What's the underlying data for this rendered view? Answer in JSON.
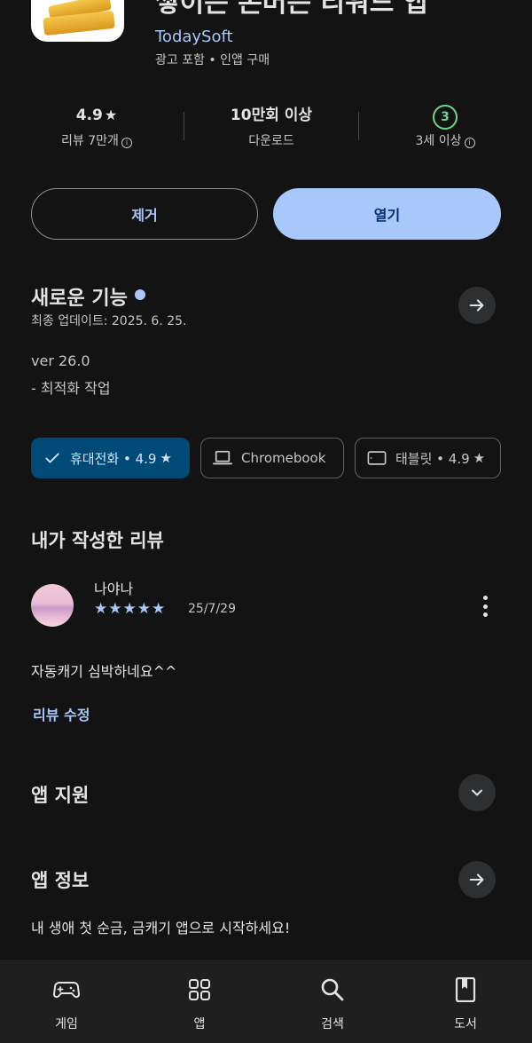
{
  "app": {
    "title": "쌓이는 돈버는 리워드 앱",
    "developer": "TodaySoft",
    "meta": "광고 포함 • 인앱 구매"
  },
  "stats": {
    "rating_value": "4.9",
    "rating_label": "리뷰 7만개",
    "downloads_value": "10만회 이상",
    "downloads_label": "다운로드",
    "age_value": "3",
    "age_label": "3세 이상"
  },
  "actions": {
    "uninstall_label": "제거",
    "open_label": "열기"
  },
  "whats_new": {
    "title": "새로운 기능",
    "last_updated": "최종 업데이트: 2025. 6. 25.",
    "version": "ver 26.0",
    "change": "- 최적화 작업"
  },
  "device_chips": [
    {
      "label": "휴대전화 • 4.9",
      "selected": true
    },
    {
      "label": "Chromebook",
      "selected": false
    },
    {
      "label": "태블릿 • 4.9",
      "selected": false
    }
  ],
  "my_review": {
    "title": "내가 작성한 리뷰",
    "reviewer": "나야나",
    "stars": "★★★★★",
    "rating": 5,
    "date": "25/7/29",
    "text": "자동캐기 심박하네요^^",
    "edit_label": "리뷰 수정"
  },
  "app_support": {
    "title": "앱 지원"
  },
  "app_info": {
    "title": "앱 정보",
    "description": "내 생애 첫 순금, 금캐기 앱으로 시작하세요!"
  },
  "bottom_nav": [
    {
      "label": "게임",
      "icon": "gamepad-icon"
    },
    {
      "label": "앱",
      "icon": "apps-grid-icon"
    },
    {
      "label": "검색",
      "icon": "search-icon"
    },
    {
      "label": "도서",
      "icon": "book-icon"
    }
  ],
  "colors": {
    "background": "#131313",
    "accent": "#a8c7fa",
    "selected_chip": "#004a77",
    "age_badge": "#6dd58c"
  }
}
